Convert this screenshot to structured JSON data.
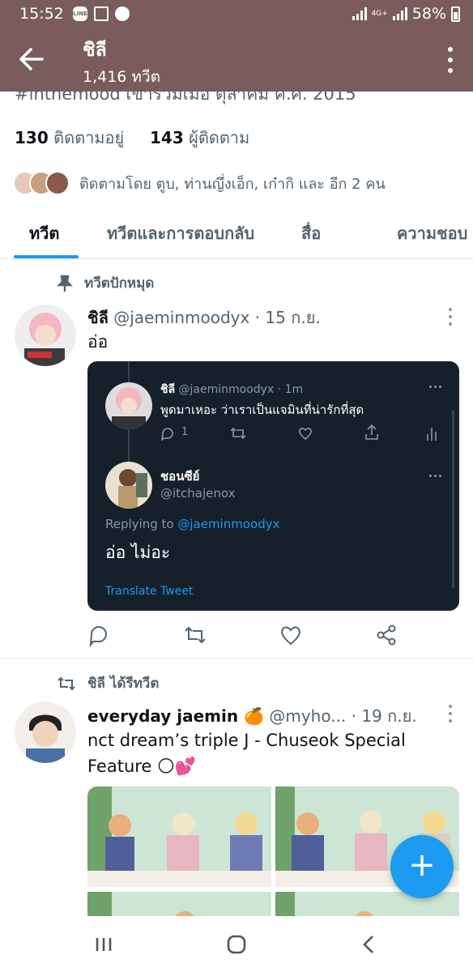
{
  "status_bar": {
    "time": "15:52",
    "network": "4G+",
    "battery": "58%"
  },
  "header": {
    "title": "ชิลี",
    "subtitle": "1,416 ทวีต"
  },
  "profile": {
    "partial_line": "#inthemood  เข้าร่วมเมื่อ ตุลาคม ค.ศ. 2015",
    "following_count": "130",
    "following_label": "กำลังติดตาม",
    "following_label_shown": "ติดตามอยู่",
    "followers_count": "143",
    "followers_label": "ผู้ติดตาม",
    "followed_by": "ติดตามโดย ตูบ, ท่านญึ่งเอ็ก, เก๋ากิ และ อีก 2 คน"
  },
  "tabs": [
    {
      "label": "ทวีต"
    },
    {
      "label": "ทวีตและการตอบกลับ"
    },
    {
      "label": "สื่อ"
    },
    {
      "label": "ความชอบ"
    }
  ],
  "tweet1": {
    "context": "ทวีตปักหมุด",
    "name": "ชิลี",
    "handle": "@jaeminmoodyx",
    "date": "· 15 ก.ย.",
    "text": "อ่อ",
    "embed": {
      "name1": "ชิลี",
      "handle1": "@jaeminmoodyx · 1m",
      "text1": "พูดมาเหอะ ว่าเราเป็นแจมินที่น่ารักที่สุด",
      "reply_count": "1",
      "name2": "ชอนซีย์",
      "handle2": "@itchajenox",
      "replying_prefix": "Replying to",
      "replying_handle": "@jaeminmoodyx",
      "main_text": "อ่อ ไม่อะ",
      "translate": "Translate Tweet"
    }
  },
  "tweet2": {
    "context": "ชิลี ได้รีทวีต",
    "name": "everyday jaemin 🍊",
    "handle": "@myho...",
    "date": "· 19 ก.ย.",
    "text_line1": "nct dream’s triple J - Chuseok Special",
    "text_line2": "Feature 🌕💕"
  },
  "fab": {
    "label": "+"
  },
  "colors": {
    "header_bg": "#7a5c5c",
    "accent": "#1d9bf0",
    "dark_embed": "#15202b"
  }
}
